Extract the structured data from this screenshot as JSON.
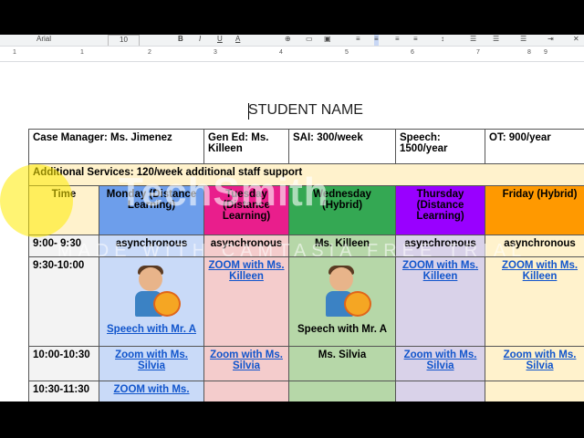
{
  "toolbar": {
    "font": "Arial",
    "size": "10"
  },
  "ruler": {
    "ticks": [
      "1",
      "1",
      "2",
      "3",
      "4",
      "5",
      "6",
      "7",
      "8",
      "9"
    ]
  },
  "document": {
    "title": "STUDENT NAME"
  },
  "table": {
    "info": {
      "case_manager": "Case Manager: Ms. Jimenez",
      "gen_ed": "Gen Ed: Ms. Killeen",
      "sai": "SAI: 300/week",
      "speech": "Speech: 1500/year",
      "ot": "OT: 900/year"
    },
    "additional": "Additional Services: 120/week additional staff support",
    "headers": {
      "time": "Time",
      "monday": "Monday (Distance Learning)",
      "tuesday": "Tuesday (Distance Learning)",
      "wednesday": "Wednesday (Hybrid)",
      "thursday": "Thursday (Distance Learning)",
      "friday": "Friday (Hybrid)"
    },
    "rows": [
      {
        "time": "9:00- 9:30",
        "mon": "asynchronous",
        "tue": "asynchronous",
        "wed": "Ms. Killeen",
        "thu": "asynchronous",
        "fri": "asynchronous"
      },
      {
        "time": "9:30-10:00",
        "mon": "Speech with Mr. A",
        "tue": "ZOOM with Ms. Killeen",
        "wed": "Speech with Mr. A",
        "thu": "ZOOM with Ms. Killeen",
        "fri": "ZOOM with Ms. Killeen"
      },
      {
        "time": "10:00-10:30",
        "mon": "Zoom with Ms. Silvia",
        "tue": "Zoom with Ms. Silvia",
        "wed": "Ms. Silvia",
        "thu": "Zoom with Ms. Silvia",
        "fri": "Zoom with Ms. Silvia"
      },
      {
        "time": "10:30-11:30",
        "mon": "ZOOM with Ms."
      }
    ]
  },
  "watermark": {
    "logo": "TechSmith",
    "banner": "MADE WITH CAMTASIA FREE TRIAL"
  }
}
